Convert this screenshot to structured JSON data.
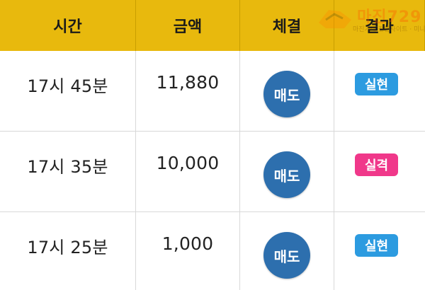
{
  "header": {
    "columns": [
      "시간",
      "금액",
      "체결",
      "결과"
    ]
  },
  "rows": [
    {
      "time": "17시 45분",
      "amount": "11,880",
      "action": "매도",
      "result": "실현",
      "result_color": "#2c9be0"
    },
    {
      "time": "17시 35분",
      "amount": "10,000",
      "action": "매도",
      "result": "실격",
      "result_color": "#f0388a"
    },
    {
      "time": "17시 25분",
      "amount": "1,000",
      "action": "매도",
      "result": "실현",
      "result_color": "#2c9be0"
    }
  ],
  "watermark": {
    "text": "마진729",
    "sub": "마진거래 전문사이트 · 미니게임 운영 사이트"
  },
  "colors": {
    "header_bg": "#e8b90d",
    "sell_button": "#2d6fae"
  }
}
